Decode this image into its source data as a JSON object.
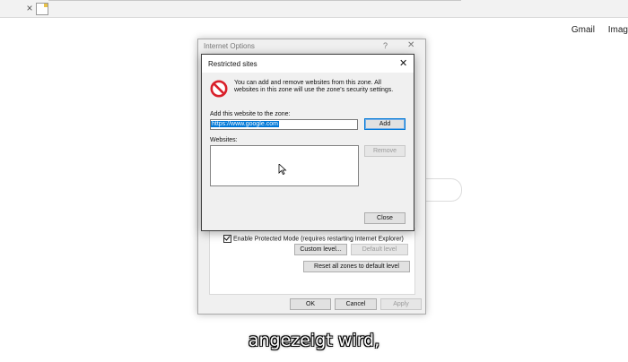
{
  "browser": {
    "tab_close_glyph": "×",
    "google_links": [
      "Gmail",
      "Imag"
    ]
  },
  "internet_options": {
    "title": "Internet Options",
    "help_glyph": "?",
    "close_glyph": "✕",
    "protected_mode_label": "Enable Protected Mode (requires restarting Internet Explorer)",
    "custom_level_label": "Custom level...",
    "default_level_label": "Default level",
    "reset_all_label": "Reset all zones to default level",
    "ok_label": "OK",
    "cancel_label": "Cancel",
    "apply_label": "Apply"
  },
  "restricted_sites": {
    "title": "Restricted sites",
    "close_glyph": "✕",
    "info_text": "You can add and remove websites from this zone. All websites in this zone will use the zone's security settings.",
    "add_label_text": "Add this website to the zone:",
    "website_input_value": "https://www.google.com",
    "add_button": "Add",
    "websites_label": "Websites:",
    "remove_button": "Remove",
    "close_button": "Close"
  },
  "subtitle": "angezeigt wird,",
  "colors": {
    "selection": "#0078d7",
    "dialog_bg": "#f0f0f0",
    "no_icon_red": "#d9202a"
  }
}
